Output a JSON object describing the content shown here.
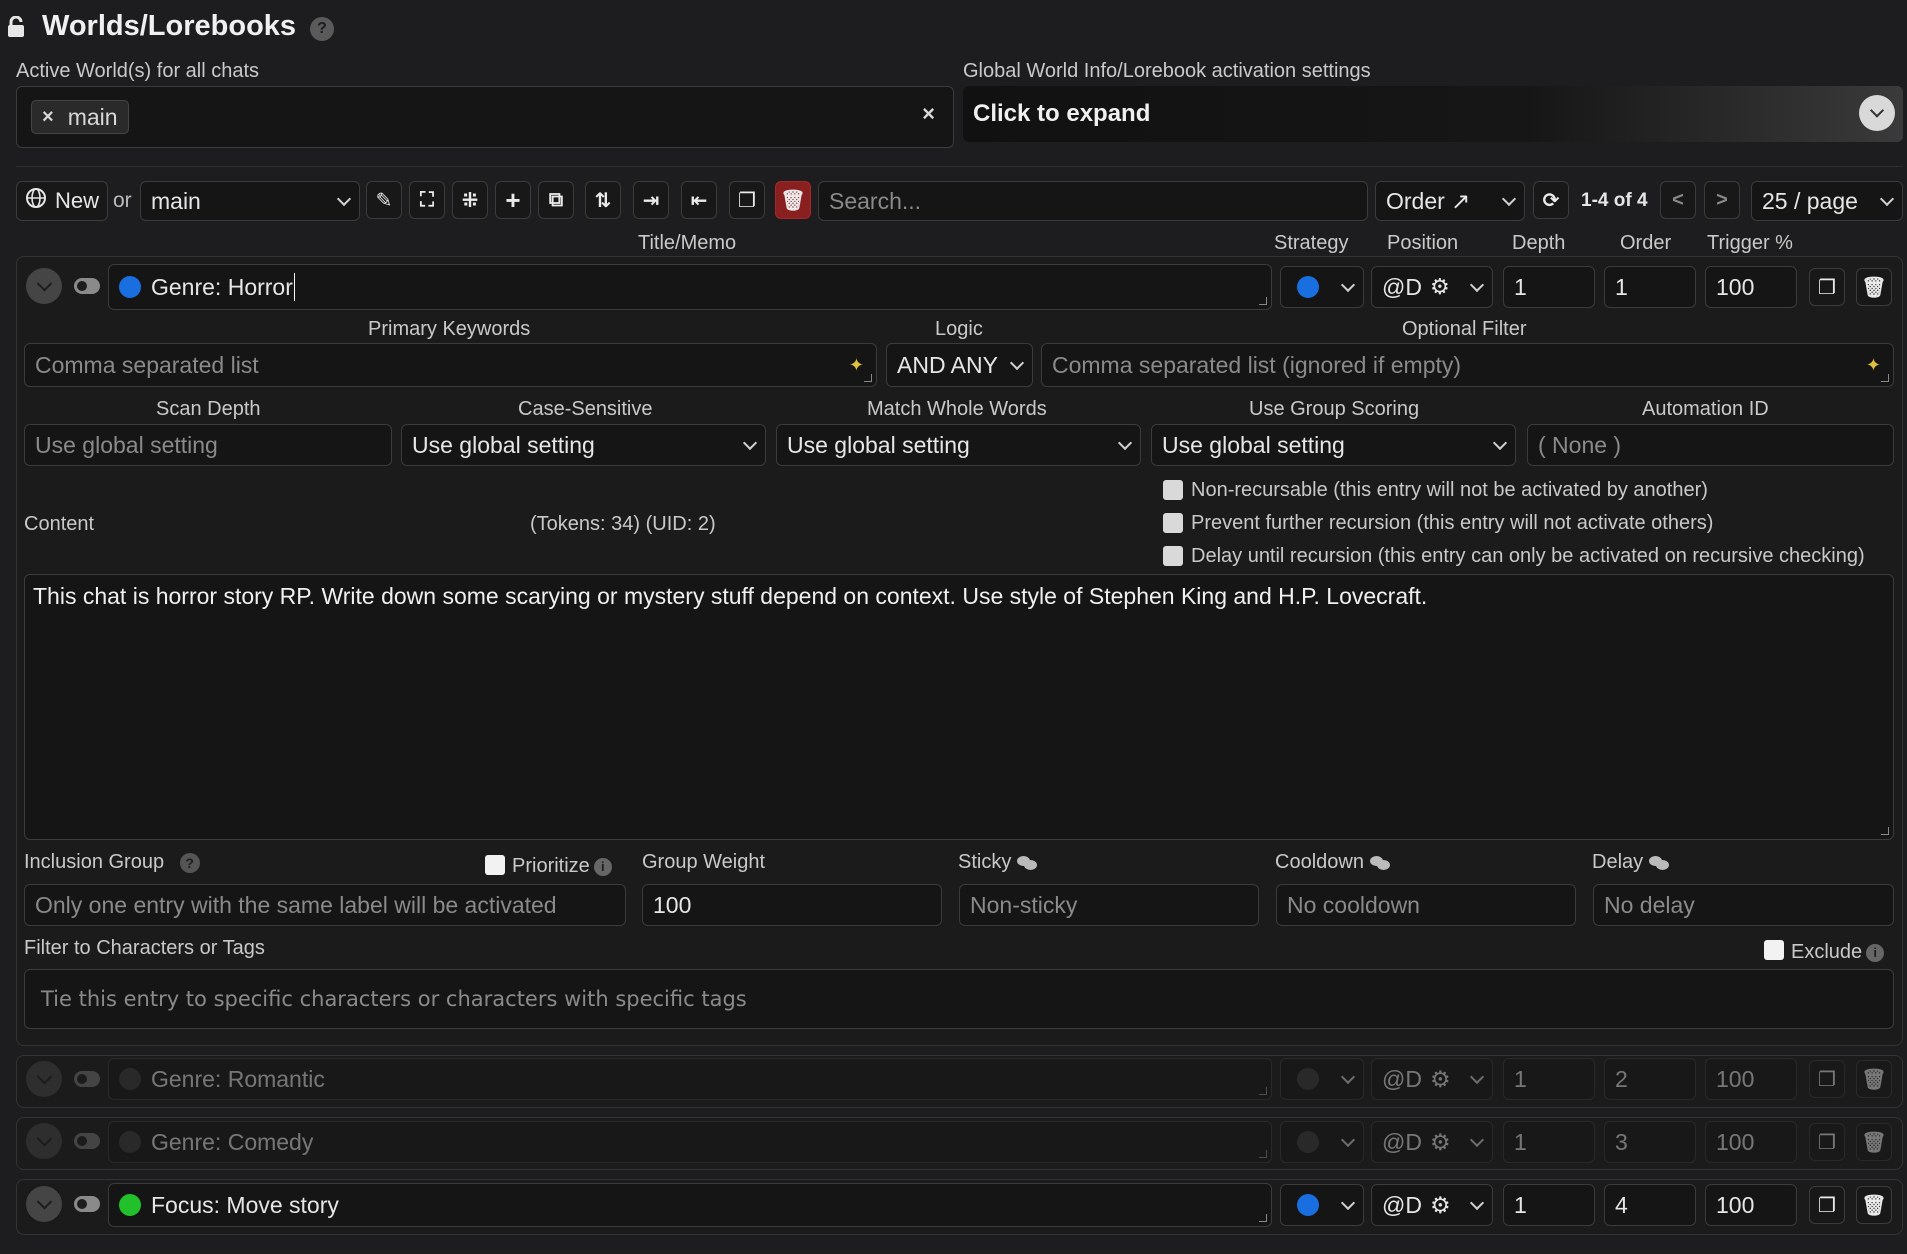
{
  "header": {
    "title": "Worlds/Lorebooks",
    "help": "?",
    "active_worlds_label": "Active World(s) for all chats",
    "active_world_chip": "main",
    "global_settings_label": "Global World Info/Lorebook activation settings",
    "expand_label": "Click to expand"
  },
  "toolbar": {
    "new_label": "New",
    "or_label": "or",
    "world_select": "main",
    "search_placeholder": "Search...",
    "sort_select": "Order ↗",
    "pagination_info": "1-4 of 4",
    "prev": "<",
    "next": ">",
    "page_size": "25 / page"
  },
  "columns": {
    "title": "Title/Memo",
    "strategy": "Strategy",
    "position": "Position",
    "depth": "Depth",
    "order": "Order",
    "trigger": "Trigger %"
  },
  "entry": {
    "title": "Genre: Horror",
    "position": "@D",
    "depth": "1",
    "order": "1",
    "trigger": "100",
    "strategy_color": "#1a6fe0",
    "primary_keywords_label": "Primary Keywords",
    "primary_keywords_placeholder": "Comma separated list",
    "logic_label": "Logic",
    "logic_value": "AND ANY",
    "optional_filter_label": "Optional Filter",
    "optional_filter_placeholder": "Comma separated list (ignored if empty)",
    "scan_depth_label": "Scan Depth",
    "scan_depth_placeholder": "Use global setting",
    "case_sensitive_label": "Case-Sensitive",
    "case_sensitive_value": "Use global setting",
    "match_whole_label": "Match Whole Words",
    "match_whole_value": "Use global setting",
    "group_scoring_label": "Use Group Scoring",
    "group_scoring_value": "Use global setting",
    "automation_label": "Automation ID",
    "automation_placeholder": "( None )",
    "content_label": "Content",
    "tokens_info": "(Tokens:  34)  (UID: 2)",
    "non_recursable": "Non-recursable (this entry will not be activated by another)",
    "prevent_recursion": "Prevent further recursion (this entry will not activate others)",
    "delay_recursion": "Delay until recursion (this entry can only be activated on recursive checking)",
    "content_text": "This chat is horror story RP. Write down some scarying or mystery stuff depend on context. Use style of Stephen King and H.P. Lovecraft.",
    "inclusion_group_label": "Inclusion Group",
    "prioritize_label": "Prioritize",
    "inclusion_group_placeholder": "Only one entry with the same label will be activated",
    "group_weight_label": "Group Weight",
    "group_weight_value": "100",
    "sticky_label": "Sticky",
    "sticky_placeholder": "Non-sticky",
    "cooldown_label": "Cooldown",
    "cooldown_placeholder": "No cooldown",
    "delay_label": "Delay",
    "delay_placeholder": "No delay",
    "filter_label": "Filter to Characters or Tags",
    "exclude_label": "Exclude",
    "filter_placeholder": "Tie this entry to specific characters or characters with specific tags"
  },
  "other_entries": [
    {
      "title": "Genre: Romantic",
      "position": "@D",
      "depth": "1",
      "order": "2",
      "trigger": "100",
      "enabled": false,
      "dot_color": "#3a3a3a"
    },
    {
      "title": "Genre: Comedy",
      "position": "@D",
      "depth": "1",
      "order": "3",
      "trigger": "100",
      "enabled": false,
      "dot_color": "#3a3a3a"
    },
    {
      "title": "Focus: Move story",
      "position": "@D",
      "depth": "1",
      "order": "4",
      "trigger": "100",
      "enabled": true,
      "dot_color": "#22c02a"
    }
  ]
}
